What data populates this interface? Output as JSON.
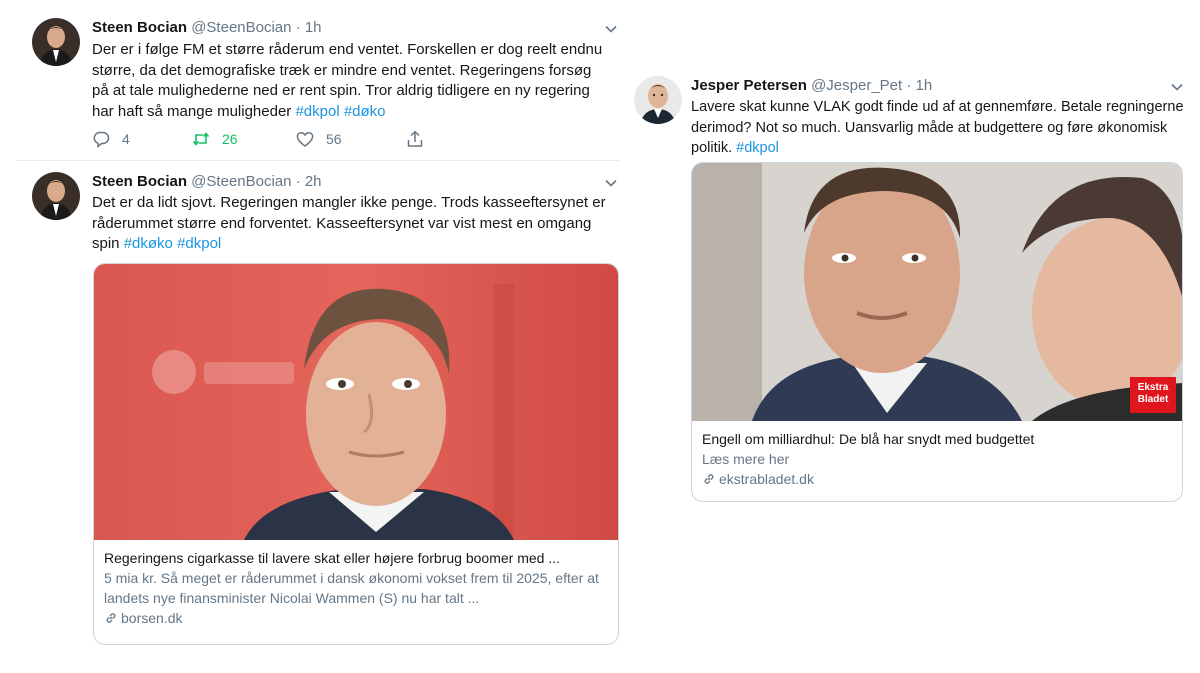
{
  "tweets": [
    {
      "name": "Steen Bocian",
      "handle": "@SteenBocian",
      "dot": "·",
      "time": "1h",
      "text": "Der er i følge FM et større råderum end ventet. Forskellen er dog reelt endnu større, da det demografiske træk er mindre end ventet. Regeringens forsøg på at tale mulighederne ned er rent spin. Tror aldrig tidligere en ny regering har haft så mange muligheder ",
      "hashtags": [
        "#dkpol",
        "#døko"
      ],
      "reply_count": "4",
      "retweet_count": "26",
      "like_count": "56",
      "icons": [
        "reply-icon",
        "retweet-icon",
        "like-icon",
        "share-icon"
      ]
    },
    {
      "name": "Steen Bocian",
      "handle": "@SteenBocian",
      "dot": "·",
      "time": "2h",
      "text": "Det er da lidt sjovt. Regeringen mangler ikke penge. Trods kasseeftersynet er råderummet større end forventet. Kasseeftersynet var vist mest en omgang spin ",
      "hashtags": [
        "#dkøko",
        "#dkpol"
      ],
      "card": {
        "title": "Regeringens cigarkasse til lavere skat eller højere forbrug boomer med ...",
        "description": "5 mia kr. Så meget er råderummet i dansk økonomi vokset frem til 2025, efter at landets nye finansminister Nicolai Wammen (S) nu har talt ...",
        "domain": "borsen.dk"
      }
    },
    {
      "name": "Jesper Petersen",
      "handle": "@Jesper_Pet",
      "dot": "·",
      "time": "1h",
      "text": "Lavere skat kunne VLAK godt finde ud af at gennemføre. Betale regningerne derimod? Not so much. Uansvarlig måde at budgettere og føre økonomisk politik. ",
      "hashtags": [
        "#dkpol"
      ],
      "card": {
        "title": "Engell om milliardhul: De blå har snydt med budgettet",
        "description": "Læs mere her",
        "domain": "ekstrabladet.dk",
        "badge": "Ekstra Bladet"
      }
    }
  ],
  "colors": {
    "hashtag": "#1b95e0",
    "retweet_active": "#17bf63",
    "muted": "#657786",
    "card_border": "#ccd6dd"
  }
}
